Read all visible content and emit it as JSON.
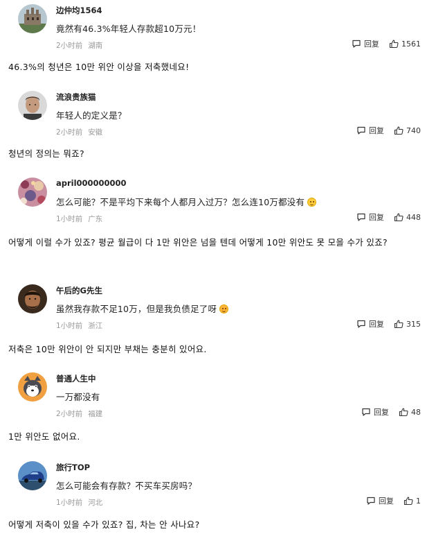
{
  "comments": [
    {
      "username": "边仲均1564",
      "text": "竟然有46.3%年轻人存款超10万元！",
      "time": "2小时前",
      "location": "湖南",
      "reply_label": "回复",
      "likes": "1561",
      "emoji": "",
      "translation": "46.3%의 청년은 10만 위안 이상을 저축했네요!"
    },
    {
      "username": "流浪贵族猫",
      "text": "年轻人的定义是？",
      "time": "2小时前",
      "location": "安徽",
      "reply_label": "回复",
      "likes": "740",
      "emoji": "",
      "translation": "청년의 정의는 뭐죠?"
    },
    {
      "username": "april000000000",
      "text": "怎么可能？不是平均下来每个人都月入过万？怎么连10万都没有",
      "time": "1小时前",
      "location": "广东",
      "reply_label": "回复",
      "likes": "448",
      "emoji": "slightly-smiling-face",
      "translation": "어떻게 이럴 수가 있죠? 평균 월급이 다 1만 위안은 넘을 텐데 어떻게 10만 위안도 못 모을 수가 있죠?"
    },
    {
      "username": "午后的G先生",
      "text": "虽然我存款不足10万，但是我负债足了呀",
      "time": "1小时前",
      "location": "浙江",
      "reply_label": "回复",
      "likes": "315",
      "emoji": "astonished-face",
      "translation": "저축은 10만 위안이 안 되지만 부채는 충분히 있어요."
    },
    {
      "username": "普通人生中",
      "text": "一万都没有",
      "time": "2小时前",
      "location": "福建",
      "reply_label": "回复",
      "likes": "48",
      "emoji": "",
      "translation": "1만 위안도 없어요."
    },
    {
      "username": "旅行TOP",
      "text": "怎么可能会有存款？不买车买房吗？",
      "time": "1小时前",
      "location": "河北",
      "reply_label": "回复",
      "likes": "1",
      "emoji": "",
      "translation": "어떻게 저축이 있을 수가 있죠? 집, 차는 안 사나요?"
    }
  ],
  "icons": {
    "reply": "comment-bubble-icon",
    "like": "thumbs-up-icon"
  }
}
